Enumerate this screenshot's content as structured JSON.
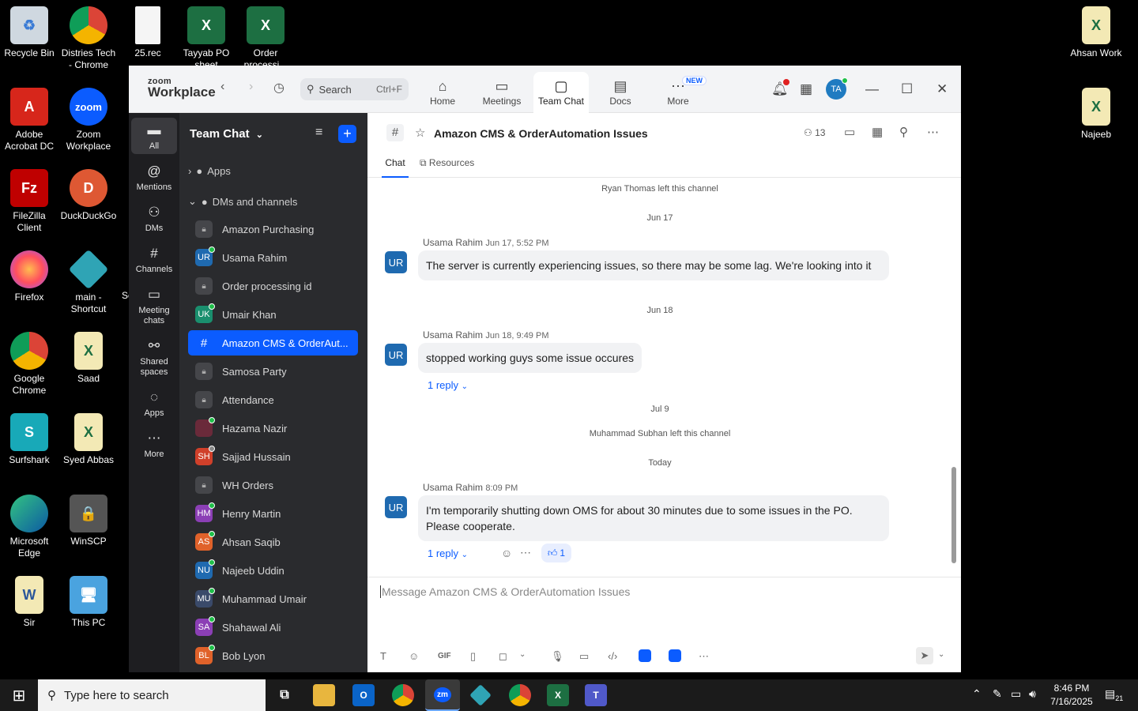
{
  "desktop": {
    "icons": [
      {
        "label": "Recycle Bin",
        "icon": "recycle-bin-icon"
      },
      {
        "label": "Distries Tech - Chrome",
        "icon": "chrome-icon"
      },
      {
        "label": "25.rec",
        "icon": "file-icon"
      },
      {
        "label": "Tayyab PO sheet",
        "icon": "excel-icon"
      },
      {
        "label": "Order processi...",
        "icon": "excel-icon"
      },
      {
        "label": "Adobe Acrobat DC",
        "icon": "acrobat-icon"
      },
      {
        "label": "Zoom Workplace",
        "icon": "zoom-icon"
      },
      {
        "label": "FileZilla Client",
        "icon": "filezilla-icon"
      },
      {
        "label": "DuckDuckGo",
        "icon": "duckduckgo-icon"
      },
      {
        "label": "Firefox",
        "icon": "firefox-icon"
      },
      {
        "label": "main - Shortcut",
        "icon": "shortcut-icon"
      },
      {
        "label": "Google Chrome",
        "icon": "chrome-icon"
      },
      {
        "label": "Saad",
        "icon": "excel-file-icon"
      },
      {
        "label": "Surfshark",
        "icon": "surfshark-icon"
      },
      {
        "label": "Syed Abbas",
        "icon": "excel-file-icon"
      },
      {
        "label": "Microsoft Edge",
        "icon": "edge-icon"
      },
      {
        "label": "WinSCP",
        "icon": "winscp-icon"
      },
      {
        "label": "Sir",
        "icon": "word-file-icon"
      },
      {
        "label": "This PC",
        "icon": "this-pc-icon"
      },
      {
        "label": "Ahsan Work",
        "icon": "excel-file-icon"
      },
      {
        "label": "Najeeb",
        "icon": "excel-file-icon"
      }
    ],
    "partial_label": "Sc"
  },
  "window": {
    "logo_top": "zoom",
    "logo_bottom": "Workplace",
    "search_label": "Search",
    "search_shortcut": "Ctrl+F",
    "tabs": [
      {
        "label": "Home",
        "icon": "home-icon"
      },
      {
        "label": "Meetings",
        "icon": "video-icon"
      },
      {
        "label": "Team Chat",
        "icon": "chat-icon"
      },
      {
        "label": "Docs",
        "icon": "docs-icon"
      },
      {
        "label": "More",
        "icon": "more-icon"
      }
    ],
    "new_badge": "NEW",
    "avatar_initials": "TA"
  },
  "rail": [
    {
      "label": "All",
      "icon": "chat-bubble-icon"
    },
    {
      "label": "Mentions",
      "icon": "at-icon"
    },
    {
      "label": "DMs",
      "icon": "people-icon"
    },
    {
      "label": "Channels",
      "icon": "hash-icon"
    },
    {
      "label": "Meeting chats",
      "icon": "calendar-icon"
    },
    {
      "label": "Shared spaces",
      "icon": "shared-icon"
    },
    {
      "label": "Apps",
      "icon": "apps-icon"
    },
    {
      "label": "More",
      "icon": "more-icon"
    }
  ],
  "channel_list": {
    "title": "Team Chat",
    "section_apps": "Apps",
    "section_dms": "DMs and channels",
    "items": [
      {
        "label": "Amazon Purchasing",
        "type": "lock",
        "initials": ""
      },
      {
        "label": "Usama Rahim",
        "type": "user",
        "initials": "UR",
        "color": "#1f6ab0"
      },
      {
        "label": "Order processing id",
        "type": "lock",
        "initials": ""
      },
      {
        "label": "Umair Khan",
        "type": "user",
        "initials": "UK",
        "color": "#1a8f6e"
      },
      {
        "label": "Amazon CMS & OrderAut...",
        "type": "hash",
        "initials": "#"
      },
      {
        "label": "Samosa Party",
        "type": "lock",
        "initials": ""
      },
      {
        "label": "Attendance",
        "type": "lock",
        "initials": ""
      },
      {
        "label": "Hazama Nazir",
        "type": "user",
        "initials": "",
        "color": "#6a2a3a"
      },
      {
        "label": "Sajjad Hussain",
        "type": "user",
        "initials": "SH",
        "color": "#d0402a"
      },
      {
        "label": "WH Orders",
        "type": "lock",
        "initials": ""
      },
      {
        "label": "Henry Martin",
        "type": "user",
        "initials": "HM",
        "color": "#8b3fb5"
      },
      {
        "label": "Ahsan Saqib",
        "type": "user",
        "initials": "AS",
        "color": "#e0622a"
      },
      {
        "label": "Najeeb Uddin",
        "type": "user",
        "initials": "NU",
        "color": "#1f6ab0"
      },
      {
        "label": "Muhammad Umair",
        "type": "user",
        "initials": "MU",
        "color": "#3a4a6a"
      },
      {
        "label": "Shahawal Ali",
        "type": "user",
        "initials": "SA",
        "color": "#8b3fb5"
      },
      {
        "label": "Bob Lyon",
        "type": "user",
        "initials": "BL",
        "color": "#e0622a"
      }
    ]
  },
  "chat": {
    "title": "Amazon CMS & OrderAutomation Issues",
    "member_count": "13",
    "tab_chat": "Chat",
    "tab_resources": "Resources",
    "sys1": "Ryan Thomas left this channel",
    "date1": "Jun 17",
    "msg1": {
      "sender": "Usama Rahim",
      "time": "Jun 17, 5:52 PM",
      "initials": "UR",
      "text": "The server is currently experiencing issues, so there may be some lag. We're looking into it"
    },
    "date2": "Jun 18",
    "msg2": {
      "sender": "Usama Rahim",
      "time": "Jun 18, 9:49 PM",
      "initials": "UR",
      "text": "stopped working guys some issue occures",
      "reply": "1 reply"
    },
    "date3": "Jul 9",
    "sys2": "Muhammad Subhan left this channel",
    "date4": "Today",
    "msg3": {
      "sender": "Usama Rahim",
      "time": "8:09 PM",
      "initials": "UR",
      "text": "I'm temporarily shutting down OMS for about 30 minutes due to some issues in the PO. Please cooperate.",
      "reply": "1 reply",
      "reaction_count": "1"
    },
    "composer_placeholder": "Message Amazon CMS & OrderAutomation Issues"
  },
  "taskbar": {
    "search_placeholder": "Type here to search",
    "time": "8:46 PM",
    "date": "7/16/2025",
    "notif_count": "21"
  }
}
